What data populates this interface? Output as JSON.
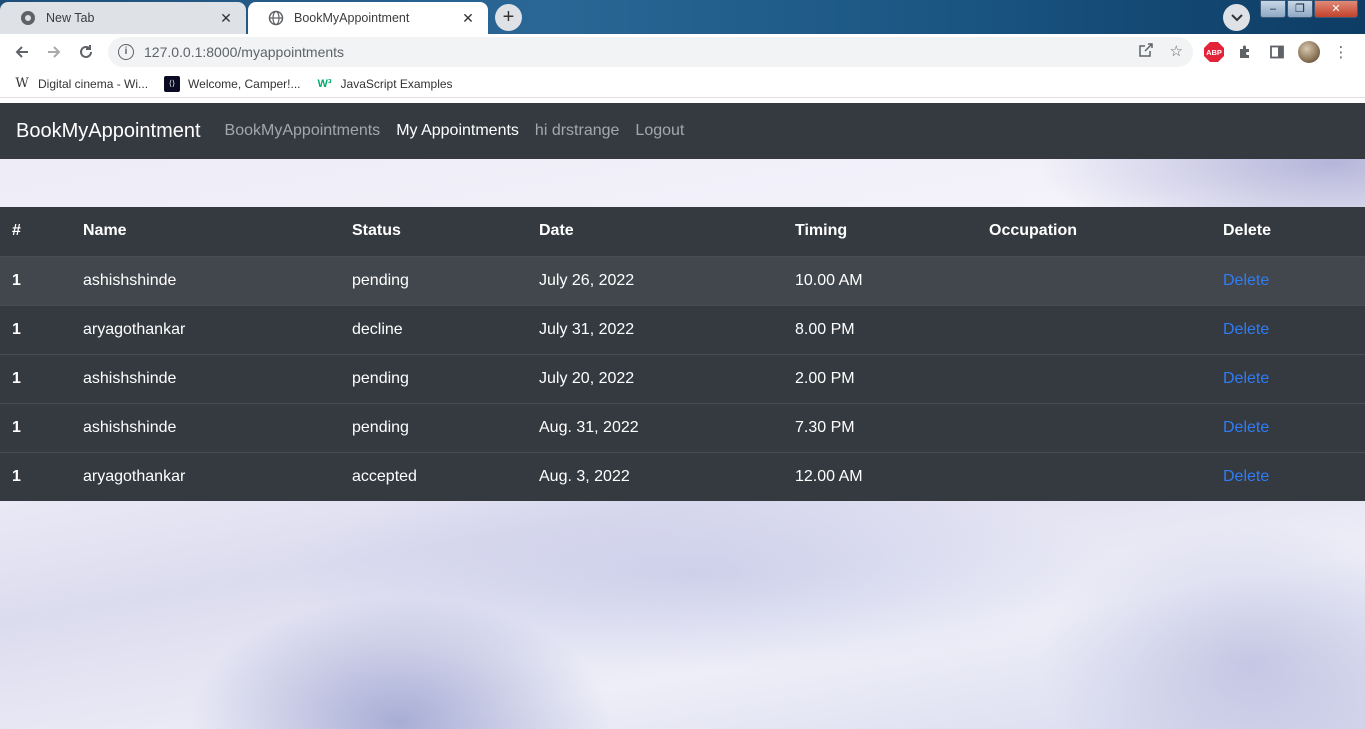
{
  "browser": {
    "tabs": [
      {
        "title": "New Tab",
        "close": "✕"
      },
      {
        "title": "BookMyAppointment",
        "close": "✕"
      }
    ],
    "new_tab": "+",
    "url": "127.0.0.1:8000/myappointments",
    "bookmarks": [
      {
        "label": "Digital cinema - Wi...",
        "icon": "wikipedia-icon",
        "glyph": "W"
      },
      {
        "label": "Welcome, Camper!...",
        "icon": "freecodecamp-icon",
        "glyph": "⟨⟩"
      },
      {
        "label": "JavaScript Examples",
        "icon": "w3schools-icon",
        "glyph": "W³"
      }
    ],
    "extension_abp": "ABP"
  },
  "navbar": {
    "brand": "BookMyAppointment",
    "links": [
      {
        "label": "BookMyAppointments",
        "active": false
      },
      {
        "label": "My Appointments",
        "active": true
      },
      {
        "label": "hi drstrange",
        "active": false
      },
      {
        "label": "Logout",
        "active": false
      }
    ]
  },
  "table": {
    "headers": [
      "#",
      "Name",
      "Status",
      "Date",
      "Timing",
      "Occupation",
      "Delete"
    ],
    "rows": [
      {
        "num": "1",
        "name": "ashishshinde",
        "status": "pending",
        "date": "July 26, 2022",
        "timing": "10.00 AM",
        "occupation": "",
        "delete": "Delete"
      },
      {
        "num": "1",
        "name": "aryagothankar",
        "status": "decline",
        "date": "July 31, 2022",
        "timing": "8.00 PM",
        "occupation": "",
        "delete": "Delete"
      },
      {
        "num": "1",
        "name": "ashishshinde",
        "status": "pending",
        "date": "July 20, 2022",
        "timing": "2.00 PM",
        "occupation": "",
        "delete": "Delete"
      },
      {
        "num": "1",
        "name": "ashishshinde",
        "status": "pending",
        "date": "Aug. 31, 2022",
        "timing": "7.30 PM",
        "occupation": "",
        "delete": "Delete"
      },
      {
        "num": "1",
        "name": "aryagothankar",
        "status": "accepted",
        "date": "Aug. 3, 2022",
        "timing": "12.00 AM",
        "occupation": "",
        "delete": "Delete"
      }
    ]
  },
  "colors": {
    "navbar_bg": "#343a40",
    "link": "#2f7df6"
  }
}
